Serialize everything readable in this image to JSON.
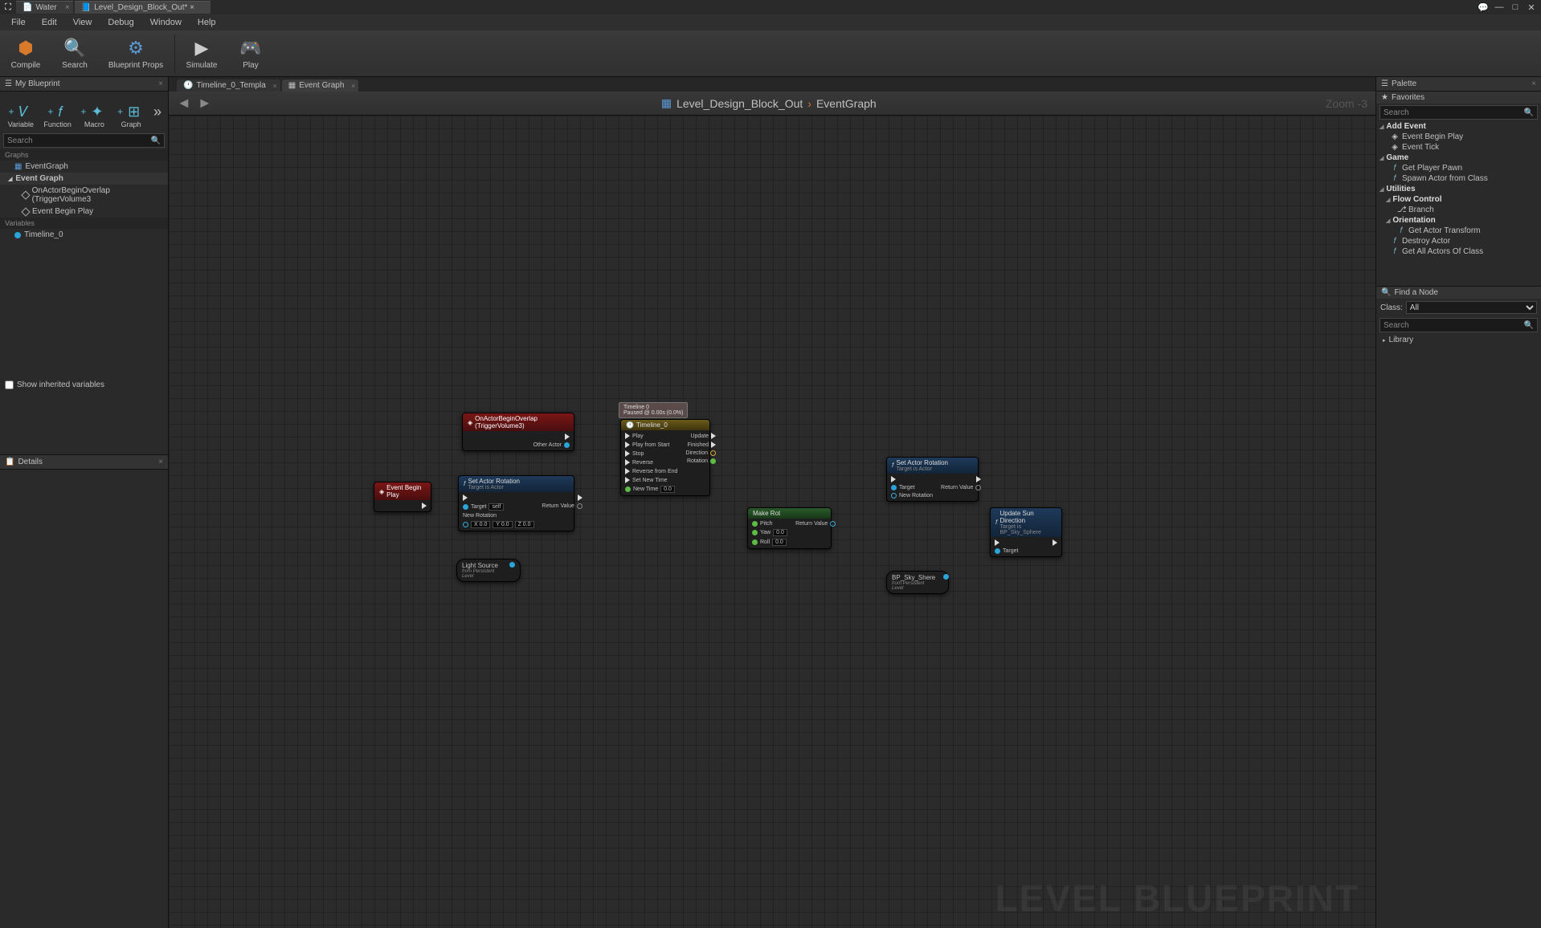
{
  "titlebar": {
    "tabs": [
      {
        "icon": "📄",
        "label": "Water"
      },
      {
        "icon": "📘",
        "label": "Level_Design_Block_Out* ×"
      }
    ],
    "win": {
      "min": "—",
      "max": "□",
      "close": "✕",
      "msg": "💬"
    }
  },
  "menubar": [
    "File",
    "Edit",
    "View",
    "Debug",
    "Window",
    "Help"
  ],
  "toolbar": {
    "compile": "Compile",
    "search": "Search",
    "bprops": "Blueprint Props",
    "simulate": "Simulate",
    "play": "Play"
  },
  "mybp": {
    "title": "My Blueprint",
    "add": {
      "variable": "Variable",
      "function": "Function",
      "macro": "Macro",
      "graph": "Graph"
    },
    "search_ph": "Search",
    "sect_graphs": "Graphs",
    "eventgraph": "EventGraph",
    "eg_node": "Event Graph",
    "child1": "OnActorBeginOverlap (TriggerVolume3",
    "child2": "Event Begin Play",
    "sect_vars": "Variables",
    "var1": "Timeline_0",
    "showinherited": "Show inherited variables"
  },
  "details": {
    "title": "Details"
  },
  "edtabs": {
    "t1": "Timeline_0_Templa",
    "t2": "Event Graph"
  },
  "navbar": {
    "crumb1": "Level_Design_Block_Out",
    "crumb2": "EventGraph",
    "zoom": "Zoom -3"
  },
  "watermark": "LEVEL BLUEPRINT",
  "nodes": {
    "overlap": {
      "title": "OnActorBeginOverlap (TriggerVolume3)",
      "other": "Other Actor"
    },
    "beginplay": {
      "title": "Event Begin Play"
    },
    "setrot1": {
      "title": "Set Actor Rotation",
      "sub": "Target is Actor",
      "target": "Target",
      "self": "self",
      "newrot": "New Rotation",
      "x": "X 0.0",
      "y": "Y 0.0",
      "z": "Z 0.0",
      "ret": "Return Value"
    },
    "timeline_tip": {
      "l1": "Timeline 0",
      "l2": "Paused @ 0.00s (0.0%)"
    },
    "timeline": {
      "title": "Timeline_0",
      "play": "Play",
      "playstart": "Play from Start",
      "stop": "Stop",
      "reverse": "Reverse",
      "revend": "Reverse from End",
      "setnew": "Set New Time",
      "newtime": "New Time",
      "nt_val": "0.0",
      "update": "Update",
      "finished": "Finished",
      "direction": "Direction",
      "rotation": "Rotation"
    },
    "makerot": {
      "title": "Make Rot",
      "pitch": "Pitch",
      "yaw": "Yaw",
      "roll": "Roll",
      "val": "0.0",
      "ret": "Return Value"
    },
    "setrot2": {
      "title": "Set Actor Rotation",
      "sub": "Target is Actor",
      "target": "Target",
      "newrot": "New Rotation",
      "ret": "Return Value"
    },
    "updatesun": {
      "title": "Update Sun Direction",
      "sub": "Target is BP_Sky_Sphere",
      "target": "Target"
    },
    "lightsrc": {
      "title": "Light Source",
      "sub": "from Persistent Level"
    },
    "skysphere": {
      "title": "BP_Sky_Shere",
      "sub": "from Persistent Level"
    }
  },
  "palette": {
    "title": "Palette",
    "fav": "Favorites",
    "search_ph": "Search",
    "cats": {
      "addevent": "Add Event",
      "ebp": "Event Begin Play",
      "et": "Event Tick",
      "game": "Game",
      "gpp": "Get Player Pawn",
      "sac": "Spawn Actor from Class",
      "util": "Utilities",
      "flow": "Flow Control",
      "branch": "Branch",
      "orient": "Orientation",
      "gat": "Get Actor Transform",
      "da": "Destroy Actor",
      "gaoc": "Get All Actors Of Class"
    }
  },
  "findnode": {
    "title": "Find a Node",
    "class": "Class:",
    "all": "All",
    "search_ph": "Search",
    "lib": "Library"
  }
}
